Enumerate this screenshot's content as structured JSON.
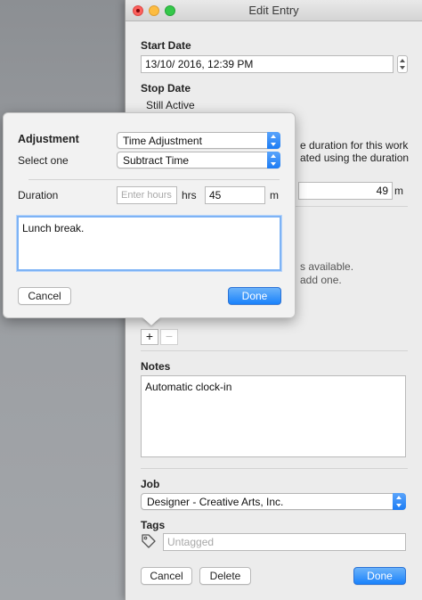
{
  "window": {
    "title": "Edit Entry"
  },
  "start_date": {
    "label": "Start Date",
    "value": "13/10/ 2016, 12:39 PM"
  },
  "stop_date": {
    "label": "Stop Date",
    "value": "Still Active"
  },
  "duration_info": {
    "line1": "e duration for this work",
    "line2": "ated using the duration",
    "value": "49",
    "unit": "m"
  },
  "adjustments_info": {
    "line1": "s available.",
    "line2": "add one."
  },
  "adjust_buttons": {
    "add": "+",
    "remove": "−"
  },
  "notes": {
    "label": "Notes",
    "value": "Automatic clock-in"
  },
  "job": {
    "label": "Job",
    "selected": "Designer - Creative Arts, Inc."
  },
  "tags": {
    "label": "Tags",
    "placeholder": "Untagged"
  },
  "footer": {
    "cancel": "Cancel",
    "delete": "Delete",
    "done": "Done"
  },
  "popover": {
    "adjustment_label": "Adjustment",
    "adjustment_value": "Time Adjustment",
    "select_label": "Select one",
    "select_value": "Subtract Time",
    "duration_label": "Duration",
    "hours_placeholder": "Enter hours",
    "hours_unit": "hrs",
    "minutes_value": "45",
    "minutes_unit": "m",
    "note": "Lunch break.",
    "cancel": "Cancel",
    "done": "Done"
  },
  "colors": {
    "accent": "#1a82fb",
    "focus_ring": "#7eb3f5",
    "window_bg": "#ececec"
  }
}
